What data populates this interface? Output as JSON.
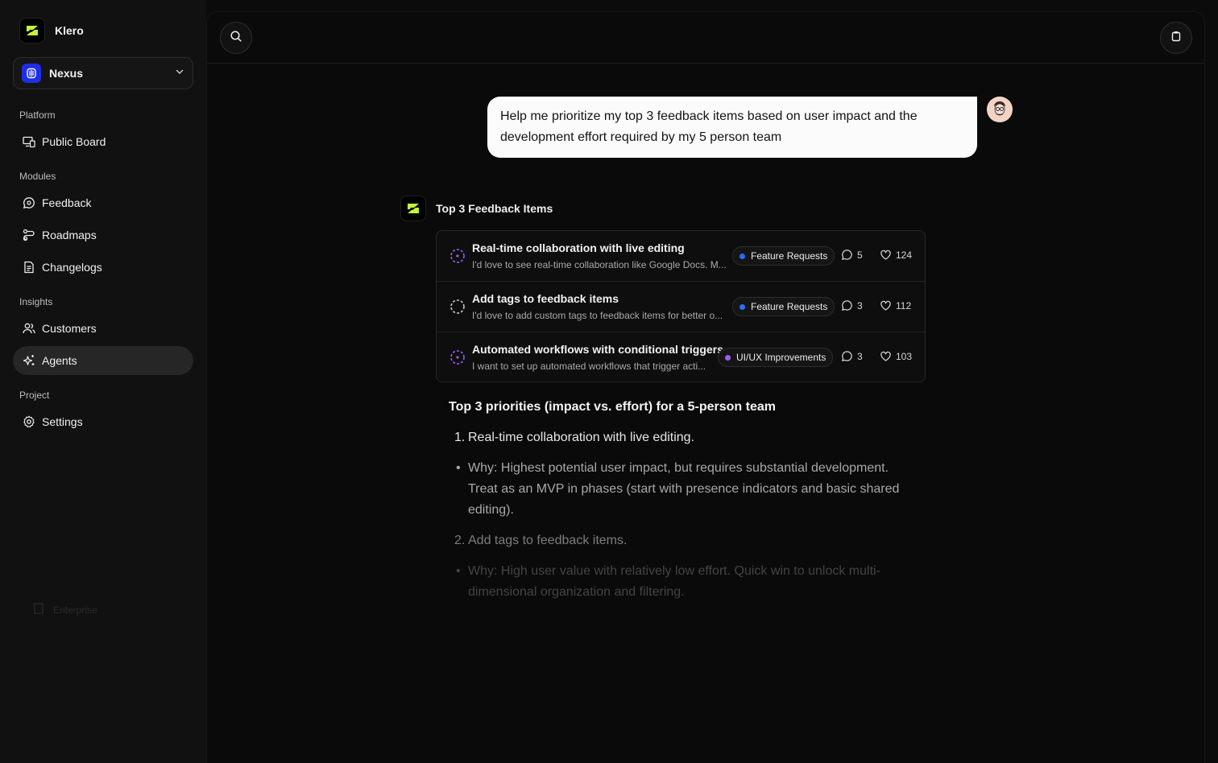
{
  "brand": {
    "name": "Klero"
  },
  "workspace": {
    "name": "Nexus"
  },
  "sidebar": {
    "sections": [
      {
        "label": "Platform",
        "items": [
          {
            "label": "Public Board",
            "icon": "monitor-phone-icon"
          }
        ]
      },
      {
        "label": "Modules",
        "items": [
          {
            "label": "Feedback",
            "icon": "message-circle-icon"
          },
          {
            "label": "Roadmaps",
            "icon": "route-icon"
          },
          {
            "label": "Changelogs",
            "icon": "document-icon"
          }
        ]
      },
      {
        "label": "Insights",
        "items": [
          {
            "label": "Customers",
            "icon": "users-icon"
          },
          {
            "label": "Agents",
            "icon": "sparkles-icon",
            "active": true
          }
        ]
      },
      {
        "label": "Project",
        "items": [
          {
            "label": "Settings",
            "icon": "gear-icon"
          }
        ]
      }
    ],
    "footer": {
      "label": "Enterprise"
    }
  },
  "chat": {
    "user_message": "Help me prioritize my top 3 feedback items based on user impact and the development effort required by my 5 person team",
    "agent_heading": "Top 3 Feedback Items",
    "items": [
      {
        "title": "Real-time collaboration with live editing",
        "description": "I'd love to see real-time collaboration like Google Docs. M...",
        "tag": "Feature Requests",
        "tag_color": "#2f6bff",
        "comments": "5",
        "votes": "124",
        "status_color": "#a259ff"
      },
      {
        "title": "Add tags to feedback items",
        "description": "I'd love to add custom tags to feedback items for better o...",
        "tag": "Feature Requests",
        "tag_color": "#2f6bff",
        "comments": "3",
        "votes": "112",
        "status_color": "#bdbdbd"
      },
      {
        "title": "Automated workflows with conditional triggers",
        "description": "I want to set up automated workflows that trigger acti...",
        "tag": "UI/UX Improvements",
        "tag_color": "#a259ff",
        "comments": "3",
        "votes": "103",
        "status_color": "#a259ff"
      }
    ],
    "answer": {
      "title": "Top 3 priorities (impact vs. effort) for a 5-person team",
      "blocks": [
        {
          "marker": "1.",
          "text": "Real-time collaboration with live editing."
        },
        {
          "marker": "•",
          "text": "Why: Highest potential user impact, but requires substantial development. Treat as an MVP in phases (start with presence indicators and basic shared editing)."
        },
        {
          "marker": "2.",
          "text": "Add tags to feedback items."
        },
        {
          "marker": "•",
          "text": "Why: High user value with relatively low effort. Quick win to unlock multi-dimensional organization and filtering."
        }
      ]
    }
  },
  "colors": {
    "accent_lime": "#c6f432",
    "workspace_blue": "#1f2ee8",
    "purple": "#a259ff",
    "blue": "#2f6bff"
  }
}
